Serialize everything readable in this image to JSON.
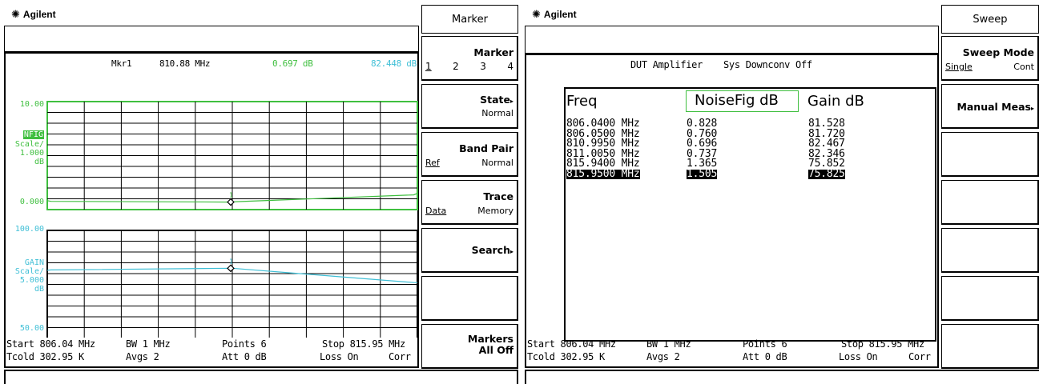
{
  "left": {
    "brand": "Agilent",
    "marker_readout": {
      "label": "Mkr1",
      "freq": "810.88 MHz",
      "nf": "0.697 dB",
      "gain": "82.448 dB"
    },
    "upper": {
      "top": "10.00",
      "param": "NFIG",
      "scale_label": "Scale/",
      "scale": "1.000",
      "unit": "dB",
      "bottom": "0.000",
      "marker": "1"
    },
    "lower": {
      "top": "100.00",
      "param": "GAIN",
      "scale_label": "Scale/",
      "scale": "5.000",
      "unit": "dB",
      "bottom": "50.00",
      "marker": "1"
    },
    "footer": {
      "start": "Start 806.04 MHz",
      "bw": "BW 1 MHz",
      "points": "Points 6",
      "stop": "Stop 815.95 MHz",
      "tcold": "Tcold 302.95 K",
      "avgs": "Avgs 2",
      "att": "Att 0 dB",
      "loss": "Loss On",
      "corr": "Corr"
    },
    "trace_nf": [
      0.828,
      0.76,
      0.696,
      0.737,
      1.365,
      1.505
    ],
    "trace_gain": [
      81.528,
      81.72,
      82.467,
      82.346,
      75.852,
      75.825
    ],
    "trace_color_nf": "#3fbf3f",
    "trace_color_gain": "#3fbfd6"
  },
  "left_softkeys": {
    "title": "Marker",
    "marker": {
      "label": "Marker",
      "options": [
        "1",
        "2",
        "3",
        "4"
      ]
    },
    "state": {
      "label": "State",
      "value": "Normal"
    },
    "band_pair": {
      "label": "Band Pair",
      "left": "Ref",
      "right": "Normal"
    },
    "trace": {
      "label": "Trace",
      "left": "Data",
      "right": "Memory"
    },
    "search": {
      "label": "Search"
    },
    "markers_off": {
      "line1": "Markers",
      "line2": "All Off"
    }
  },
  "right": {
    "brand": "Agilent",
    "header": {
      "dut": "DUT Amplifier",
      "sys": "Sys Downconv Off"
    },
    "table": {
      "headers": [
        "Freq",
        "NoiseFig dB",
        "Gain dB"
      ],
      "rows": [
        [
          "806.0400 MHz",
          "0.828",
          "81.528"
        ],
        [
          "806.0500 MHz",
          "0.760",
          "81.720"
        ],
        [
          "810.9950 MHz",
          "0.696",
          "82.467"
        ],
        [
          "811.0050 MHz",
          "0.737",
          "82.346"
        ],
        [
          "815.9400 MHz",
          "1.365",
          "75.852"
        ],
        [
          "815.9500 MHz",
          "1.505",
          "75.825"
        ]
      ]
    },
    "footer": {
      "start": "Start 806.04 MHz",
      "bw": "BW 1 MHz",
      "points": "Points 6",
      "stop": "Stop 815.95 MHz",
      "tcold": "Tcold 302.95 K",
      "avgs": "Avgs 2",
      "att": "Att 0 dB",
      "loss": "Loss On",
      "corr": "Corr"
    }
  },
  "right_softkeys": {
    "title": "Sweep",
    "sweep_mode": {
      "label": "Sweep Mode",
      "left": "Single",
      "right": "Cont"
    },
    "manual_meas": {
      "label": "Manual Meas"
    }
  }
}
